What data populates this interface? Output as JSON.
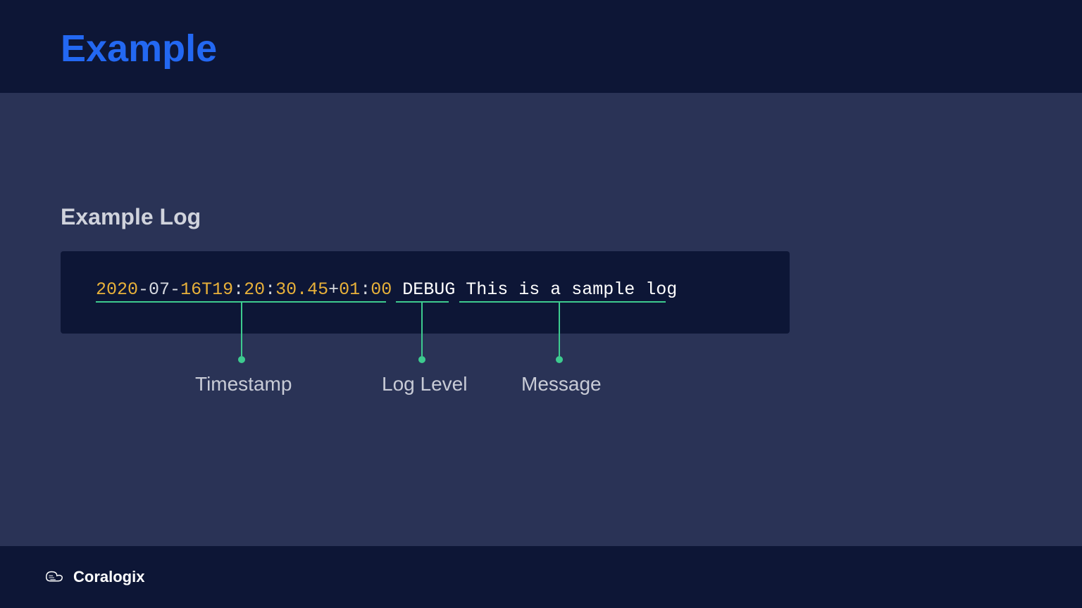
{
  "header": {
    "title": "Example"
  },
  "section": {
    "title": "Example Log"
  },
  "log": {
    "year": "2020",
    "dash1": "-",
    "month": "07",
    "dash2": "-",
    "day": "16",
    "t": "T19",
    "c1": ":",
    "min": "20",
    "c2": ":",
    "sec": "30.45",
    "plus": "+",
    "oh": "01",
    "c3": ":",
    "om": "00",
    "space": " ",
    "level": "DEBUG",
    "space2": " ",
    "message": "This is a sample log"
  },
  "callouts": {
    "timestamp": "Timestamp",
    "level": "Log Level",
    "message": "Message"
  },
  "footer": {
    "brand": "Coralogix"
  }
}
